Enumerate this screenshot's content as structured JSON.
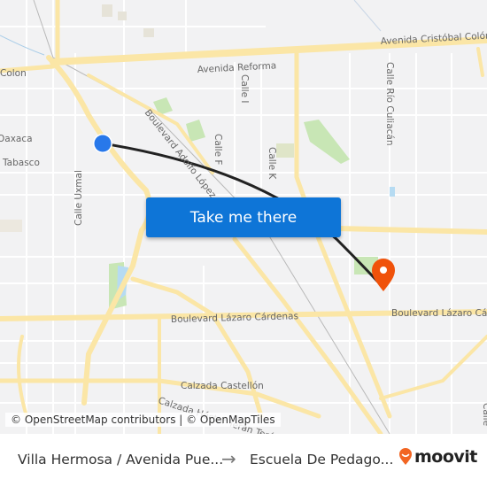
{
  "map": {
    "street_labels": [
      {
        "text": "Avenida Cristóbal Colón",
        "id": "cristobal-colon"
      },
      {
        "text": "Avenida Reforma",
        "id": "reforma"
      },
      {
        "text": "Colon",
        "id": "colon"
      },
      {
        "text": "Calle I",
        "id": "calle-i"
      },
      {
        "text": "Calle Río Culiacán",
        "id": "rio-culiacan"
      },
      {
        "text": "Oaxaca",
        "id": "oaxaca"
      },
      {
        "text": "Boulevard Adolfo López",
        "id": "adolfo-lopez"
      },
      {
        "text": "Calle F",
        "id": "calle-f"
      },
      {
        "text": "Calle K",
        "id": "calle-k"
      },
      {
        "text": "Tabasco",
        "id": "tabasco"
      },
      {
        "text": "Calle Uxmal",
        "id": "uxmal"
      },
      {
        "text": "Boulevard Lázaro Cárdenas",
        "id": "lazaro-cardenas-west"
      },
      {
        "text": "Boulevard Lázaro Cárdenas",
        "id": "lazaro-cardenas-east"
      },
      {
        "text": "Calzada Castellón",
        "id": "castellon"
      },
      {
        "text": "Calzada Héctor Terán Terán",
        "id": "teran"
      },
      {
        "text": "Calle",
        "id": "calle-right"
      }
    ],
    "origin_marker_color": "#2878ea",
    "destination_marker_color": "#f0520a",
    "route_color": "#222222"
  },
  "cta": {
    "label": "Take me there",
    "color": "#0e75d7"
  },
  "attribution": "© OpenStreetMap contributors | © OpenMapTiles",
  "footer": {
    "from": "Villa Hermosa / Avenida Pue...",
    "arrow": "→",
    "to": "Escuela De Pedago...",
    "brand": "moovit",
    "brand_color": "#f26522"
  }
}
